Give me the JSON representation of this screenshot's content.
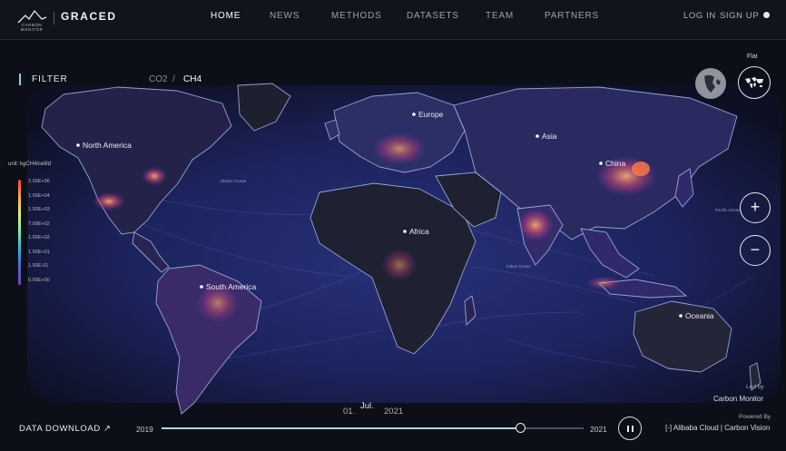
{
  "logo": {
    "brand": "CARBON MONITOR",
    "product": "GRACED"
  },
  "nav": {
    "home": "HOME",
    "news": "NEWS",
    "methods": "METHODS",
    "datasets": "DATASETS",
    "team": "TEAM",
    "partners": "PARTNERS",
    "active": "HOME"
  },
  "auth": {
    "login": "LOG IN",
    "signup": "SIGN UP"
  },
  "filter": {
    "label": "FILTER",
    "gases": [
      "CO2",
      "CH4"
    ],
    "separator": "/",
    "selected": "CH4"
  },
  "view": {
    "mode_label": "Flat"
  },
  "legend": {
    "unit": "unit: kgCH4/cell/d",
    "ticks": [
      "2.00E+06",
      "1.00E+04",
      "1.00E+03",
      "7.00E+02",
      "1.00E+02",
      "1.00E+01",
      "1.00E-01",
      "0.00E+00"
    ],
    "gradient_colors": [
      "#ff3c35",
      "#ffb347",
      "#e9f06a",
      "#7ff0b0",
      "#3fb8d8",
      "#4a6fd8",
      "#7a3fb8"
    ]
  },
  "map": {
    "regions": [
      {
        "name": "North America"
      },
      {
        "name": "Europe"
      },
      {
        "name": "Asia"
      },
      {
        "name": "China"
      },
      {
        "name": "Africa"
      },
      {
        "name": "South America"
      },
      {
        "name": "Oceania"
      }
    ],
    "oceans": [
      {
        "name": "Atlantic Ocean"
      },
      {
        "name": "Indian Ocean"
      },
      {
        "name": "Pacific Ocean"
      }
    ],
    "colors": {
      "ocean": "#1e2461",
      "land": "#1c1f2b",
      "border": "#b9d2ff",
      "hotspot": "#ff7a45"
    }
  },
  "footer": {
    "download": "DATA DOWNLOAD ↗",
    "year_start": "2019",
    "year_end": "2021",
    "timeline_progress": 0.85,
    "date": {
      "day": "01.",
      "month": "Jul.",
      "year": "2021"
    },
    "led_by_label": "Led by",
    "led_by_name": "Carbon Monitor",
    "powered_by_label": "Powered By",
    "powered_by_names": "[-] Alibaba Cloud | Carbon Vision"
  }
}
